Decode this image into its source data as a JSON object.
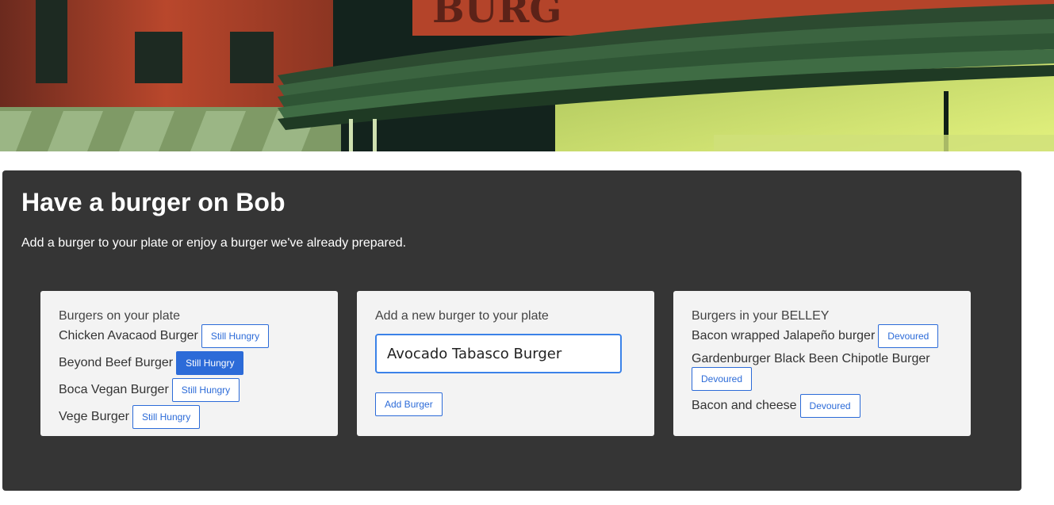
{
  "hero": {
    "sign_text": "BURG",
    "colors": {
      "sign": "#b4442a",
      "awning": "#2e4a30",
      "sky": "#d8ec7a"
    }
  },
  "header": {
    "title": "Have a burger on Bob",
    "subtitle": "Add a burger to your plate or enjoy a burger we've already prepared."
  },
  "plate": {
    "title": "Burgers on your plate",
    "items": [
      {
        "name": "Chicken Avacaod Burger",
        "button": "Still Hungry"
      },
      {
        "name": "Beyond Beef Burger",
        "button": "Still Hungry"
      },
      {
        "name": "Boca Vegan Burger",
        "button": "Still Hungry"
      },
      {
        "name": "Vege Burger",
        "button": "Still Hungry"
      }
    ]
  },
  "add_form": {
    "title": "Add a new burger to your plate",
    "input_value": "Avocado Tabasco Burger",
    "button": "Add Burger"
  },
  "belley": {
    "title": "Burgers in your BELLEY",
    "items": [
      {
        "name": "Bacon wrapped Jalapeño burger",
        "button": "Devoured"
      },
      {
        "name": "Gardenburger Black Been Chipotle Burger",
        "button": "Devoured"
      },
      {
        "name": "Bacon and cheese",
        "button": "Devoured"
      }
    ]
  },
  "colors": {
    "accent": "#2c6bd8",
    "jumbotron_bg": "#353535",
    "card_bg": "#f3f3f3"
  }
}
